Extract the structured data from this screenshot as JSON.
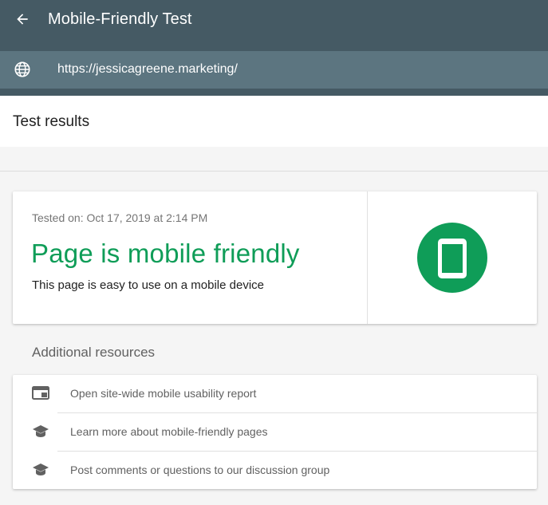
{
  "header": {
    "title": "Mobile-Friendly Test",
    "url": "https://jessicagreene.marketing/"
  },
  "results": {
    "title": "Test results",
    "tested_on": "Tested on: Oct 17, 2019 at 2:14 PM",
    "verdict": "Page is mobile friendly",
    "verdict_sub": "This page is easy to use on a mobile device",
    "verdict_color": "#0f9d58",
    "badge_icon": "phone-icon"
  },
  "resources": {
    "title": "Additional resources",
    "items": [
      {
        "icon": "browser-window-icon",
        "label": "Open site-wide mobile usability report"
      },
      {
        "icon": "graduation-cap-icon",
        "label": "Learn more about mobile-friendly pages"
      },
      {
        "icon": "graduation-cap-icon",
        "label": "Post comments or questions to our discussion group"
      }
    ]
  },
  "colors": {
    "appbar": "#455a64",
    "urlbar": "#5c7580",
    "success": "#0f9d58"
  }
}
